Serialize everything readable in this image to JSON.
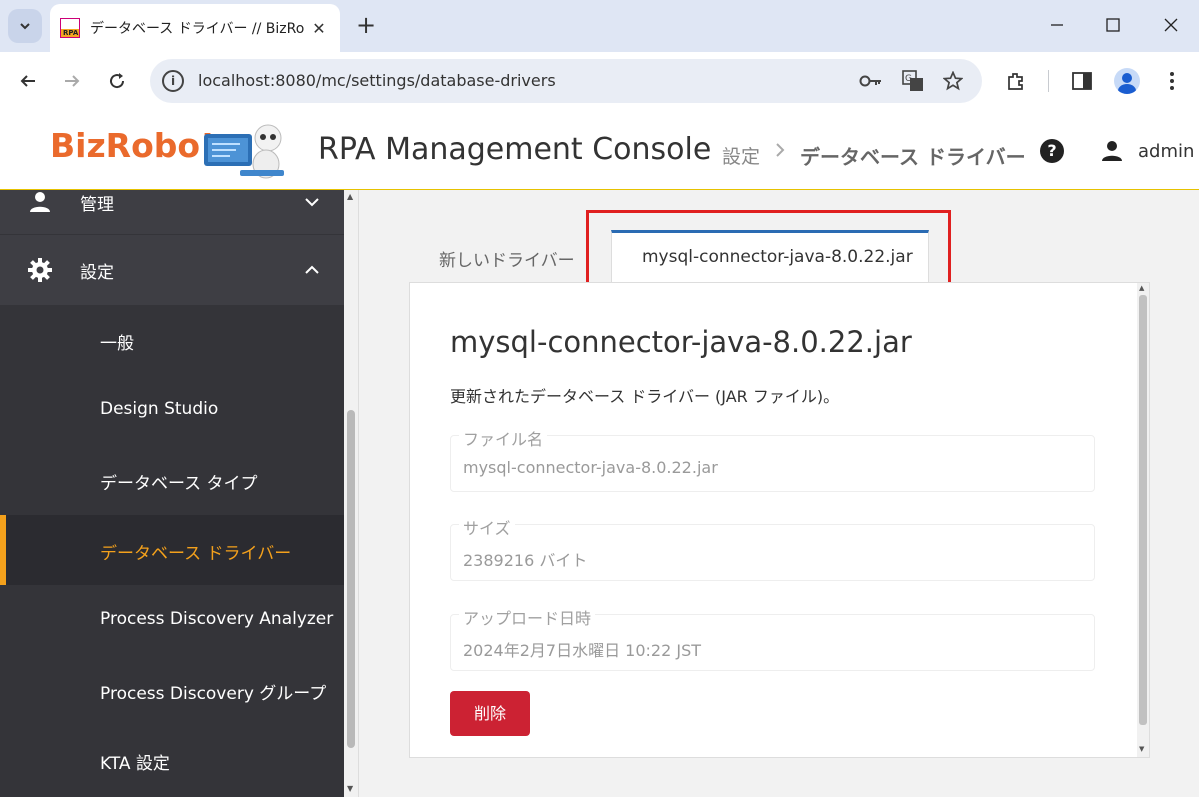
{
  "browser": {
    "tab_title": "データベース ドライバー // BizRobo! N",
    "favicon_text": "RPA",
    "address": "localhost:8080/mc/settings/database-drivers"
  },
  "header": {
    "logo_text": "BizRobo!",
    "app_title": "RPA Management Console",
    "breadcrumb": [
      "設定",
      "データベース ドライバー"
    ],
    "user": "admin"
  },
  "sidebar": {
    "sections": [
      {
        "label": "管理",
        "icon": "person-icon",
        "expanded": false
      },
      {
        "label": "設定",
        "icon": "gear-icon",
        "expanded": true
      }
    ],
    "items": [
      {
        "label": "一般"
      },
      {
        "label": "Design Studio"
      },
      {
        "label": "データベース タイプ"
      },
      {
        "label": "データベース ドライバー",
        "active": true
      },
      {
        "label": "Process Discovery Analyzer"
      },
      {
        "label": "Process Discovery グループ"
      },
      {
        "label": "KTA 設定"
      }
    ]
  },
  "main": {
    "tabs": [
      {
        "label": "新しいドライバー"
      },
      {
        "label": "mysql-connector-java-8.0.22.jar",
        "active": true
      }
    ],
    "panel": {
      "title": "mysql-connector-java-8.0.22.jar",
      "description": "更新されたデータベース ドライバー (JAR ファイル)。",
      "fields": [
        {
          "label": "ファイル名",
          "value": "mysql-connector-java-8.0.22.jar"
        },
        {
          "label": "サイズ",
          "value": "2389216 バイト"
        },
        {
          "label": "アップロード日時",
          "value": "2024年2月7日水曜日 10:22 JST"
        }
      ],
      "delete_label": "削除"
    }
  },
  "colors": {
    "accent": "#f4a11c",
    "sidebar_bg": "#343439",
    "tab_accent": "#2a6bb3",
    "delete": "#cc2233",
    "highlight": "#e02020",
    "logo": "#ea6a2c"
  }
}
